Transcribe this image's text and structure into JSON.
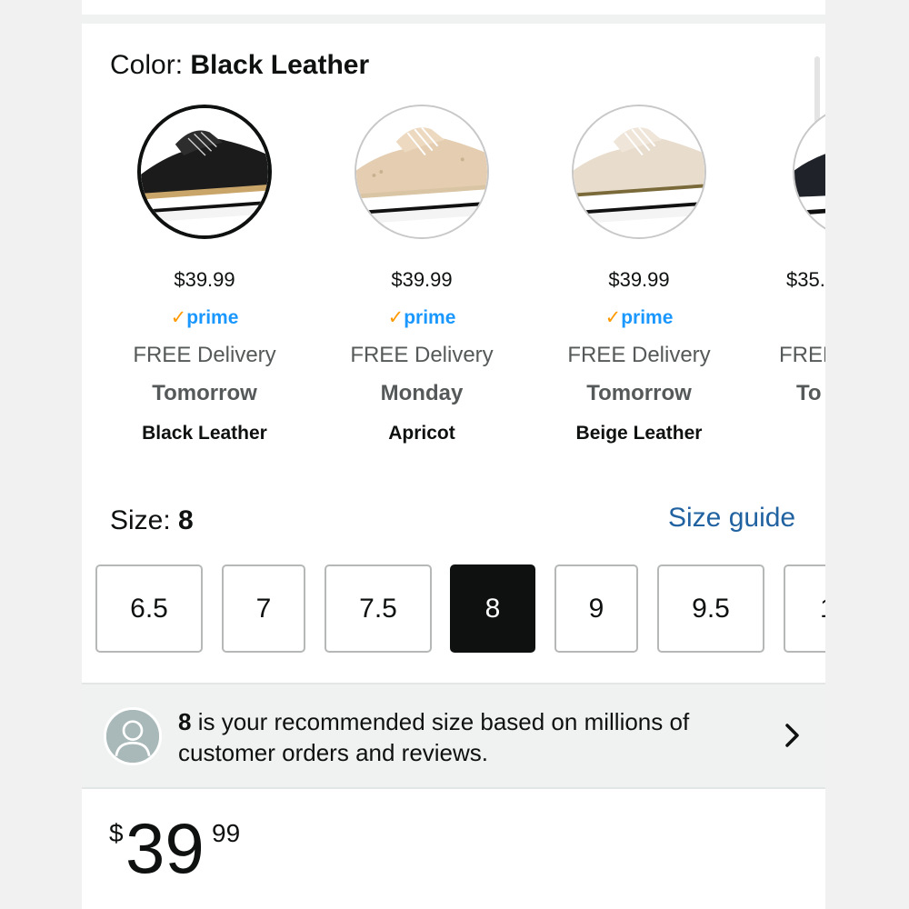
{
  "color": {
    "label": "Color:",
    "selected": "Black Leather"
  },
  "swatches": [
    {
      "price": "$39.99",
      "prime": "prime",
      "delivery": "FREE Delivery",
      "when": "Tomorrow",
      "name": "Black Leather",
      "selected": true
    },
    {
      "price": "$39.99",
      "prime": "prime",
      "delivery": "FREE Delivery",
      "when": "Monday",
      "name": "Apricot",
      "selected": false
    },
    {
      "price": "$39.99",
      "prime": "prime",
      "delivery": "FREE Delivery",
      "when": "Tomorrow",
      "name": "Beige Leather",
      "selected": false
    },
    {
      "price": "$35.",
      "prime": "",
      "delivery": "FREE",
      "when": "To",
      "name": "",
      "selected": false
    }
  ],
  "prime_check": "✓",
  "size": {
    "label": "Size:",
    "selected": "8",
    "guide_link": "Size guide",
    "options": [
      "6.5",
      "7",
      "7.5",
      "8",
      "9",
      "9.5",
      "1"
    ]
  },
  "recommendation": {
    "size": "8",
    "text": " is your recommended size based on millions of customer orders and reviews."
  },
  "price": {
    "symbol": "$",
    "whole": "39",
    "fraction": "99"
  },
  "colors": {
    "link": "#2162a1",
    "prime_blue": "#1a98ff",
    "prime_check": "#ff9900",
    "selected_bg": "#0f1111"
  }
}
